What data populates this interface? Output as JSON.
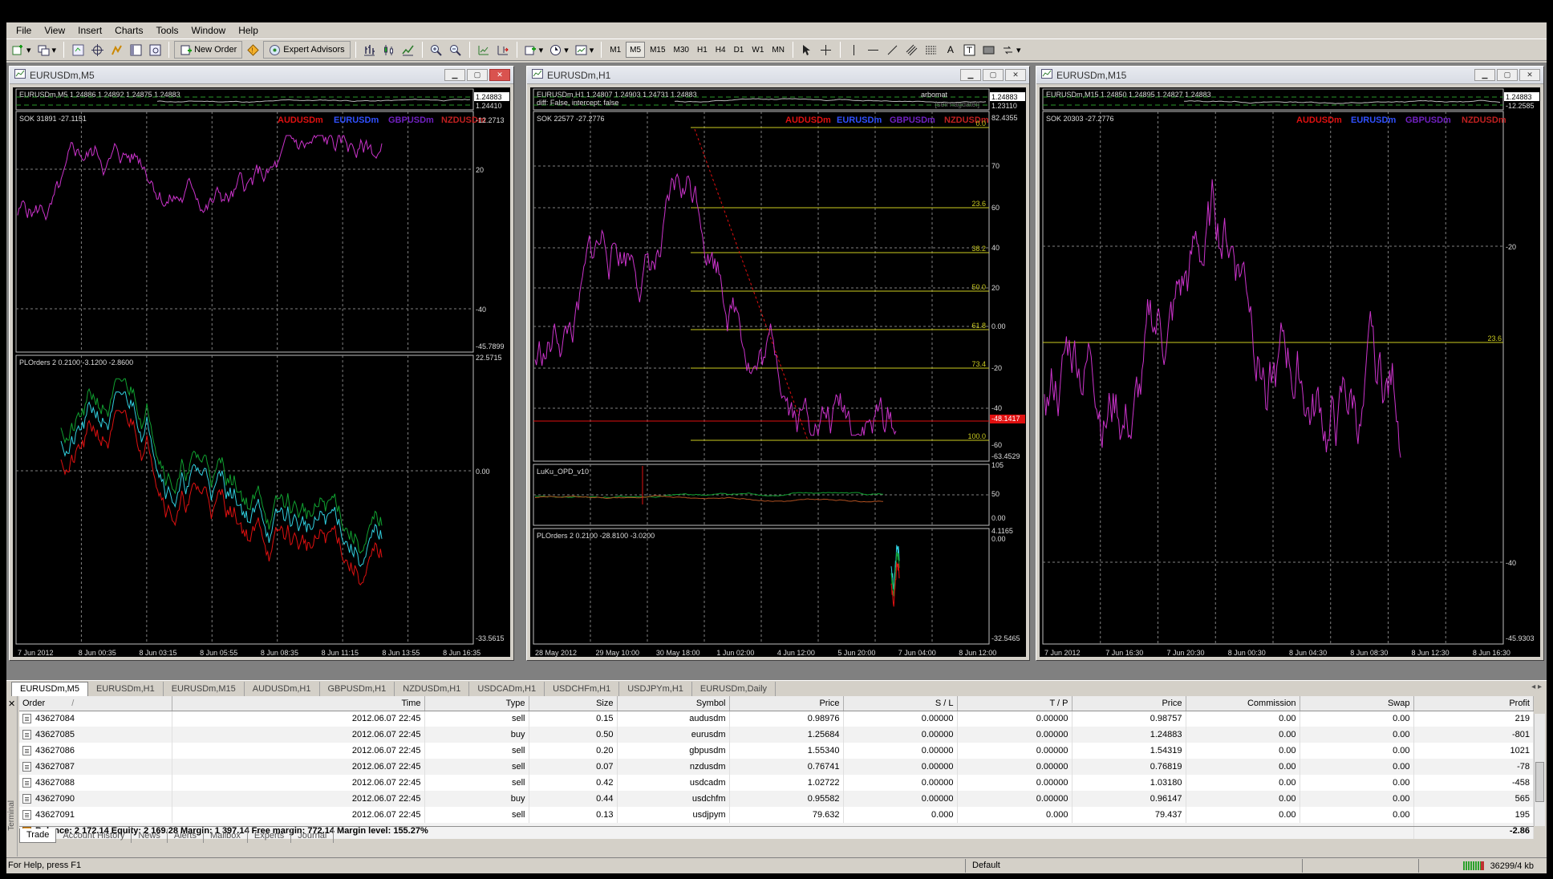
{
  "menu": [
    "File",
    "View",
    "Insert",
    "Charts",
    "Tools",
    "Window",
    "Help"
  ],
  "toolbar": {
    "new_order": "New Order",
    "expert_advisors": "Expert Advisors",
    "timeframes": [
      "M1",
      "M5",
      "M15",
      "M30",
      "H1",
      "H4",
      "D1",
      "W1",
      "MN"
    ],
    "active_timeframe": "M5",
    "text_tool": "A"
  },
  "colors": {
    "magenta": "#cc33cc",
    "red": "#e01010",
    "green": "#10a030",
    "cyan": "#30d0e0",
    "yellow": "#cccc20",
    "blue": "#3050ff",
    "purple": "#7020c0",
    "dark_red": "#c02020",
    "grid": "#808080",
    "axis": "#c0c0c0"
  },
  "windows": [
    {
      "id": "m5",
      "title": "EURUSDm,M5",
      "header": "EURUSDm,M5  1.24886 1.24892 1.24875 1.24883",
      "price_main": "1.24883",
      "price_aux": "1.24410",
      "sok_label": "SOK 31891 -27.1151",
      "legend": [
        "AUDUSDm",
        "EURUSDm",
        "GBPUSDm",
        "NZDUSDm"
      ],
      "sok_scale": [
        "-12.2713",
        "20",
        "-40",
        "-45.7899"
      ],
      "pl_label": "PLOrders 2 0.2100 -3.1200 -2.8600",
      "pl_scale": [
        "22.5715",
        "0.00",
        "-33.5615"
      ],
      "times": [
        "7 Jun 2012",
        "8 Jun 00:35",
        "8 Jun 03:15",
        "8 Jun 05:55",
        "8 Jun 08:35",
        "8 Jun 11:15",
        "8 Jun 13:55",
        "8 Jun 16:35"
      ]
    },
    {
      "id": "h1",
      "title": "EURUSDm,H1",
      "header": "EURUSDm,H1  1.24807 1.24903 1.24731 1.24883",
      "header2": "diff: False, intercept: false",
      "tag_right": "arbomat",
      "tag_right2": "[sell nagdatei]",
      "price_main": "1.24883",
      "price_aux": "1.23110",
      "sok_label": "SOK 22577 -27.2776",
      "legend": [
        "AUDUSDm",
        "EURUSDm",
        "GBPUSDm",
        "NZDUSDm"
      ],
      "sok_scale": [
        "82.4355",
        "70",
        "60",
        "40",
        "20",
        "0.00",
        "-20",
        "-40",
        "-48.1417",
        "-60",
        "-63.4529"
      ],
      "fib_levels": [
        "0.0",
        "23.6",
        "38.2",
        "50.0",
        "61.8",
        "73.4",
        "100.0"
      ],
      "opd_label": "LuKu_OPD_v10",
      "opd_scale": [
        "105",
        "50",
        "0.00"
      ],
      "pl_label": "PLOrders 2 0.2100 -28.8100 -3.0200",
      "pl_scale": [
        "4.1165",
        "0.00",
        "-32.5465"
      ],
      "times": [
        "28 May 2012",
        "29 May 10:00",
        "30 May 18:00",
        "1 Jun 02:00",
        "4 Jun 12:00",
        "5 Jun 20:00",
        "7 Jun 04:00",
        "8 Jun 12:00"
      ]
    },
    {
      "id": "m15",
      "title": "EURUSDm,M15",
      "header": "EURUSDm,M15  1.24850 1.24895 1.24827 1.24883",
      "price_main": "1.24883",
      "price_aux": "-12.2585",
      "sok_label": "SOK 20303 -27.2776",
      "legend": [
        "AUDUSDm",
        "EURUSDm",
        "GBPUSDm",
        "NZDUSDm"
      ],
      "sok_scale": [
        "-20",
        "23.6",
        "-40",
        "-45.9303"
      ],
      "times": [
        "7 Jun 2012",
        "7 Jun 16:30",
        "7 Jun 20:30",
        "8 Jun 00:30",
        "8 Jun 04:30",
        "8 Jun 08:30",
        "8 Jun 12:30",
        "8 Jun 16:30"
      ]
    }
  ],
  "chart_tabs": [
    "EURUSDm,M5",
    "EURUSDm,H1",
    "EURUSDm,M15",
    "AUDUSDm,H1",
    "GBPUSDm,H1",
    "NZDUSDm,H1",
    "USDCADm,H1",
    "USDCHFm,H1",
    "USDJPYm,H1",
    "EURUSDm,Daily"
  ],
  "terminal": {
    "side_label": "Terminal",
    "columns": [
      "Order",
      "Time",
      "Type",
      "Size",
      "Symbol",
      "Price",
      "S / L",
      "T / P",
      "Price",
      "Commission",
      "Swap",
      "Profit"
    ],
    "sort_marker": "/",
    "rows": [
      [
        "43627084",
        "2012.06.07 22:45",
        "sell",
        "0.15",
        "audusdm",
        "0.98976",
        "0.00000",
        "0.00000",
        "0.98757",
        "0.00",
        "0.00",
        "219"
      ],
      [
        "43627085",
        "2012.06.07 22:45",
        "buy",
        "0.50",
        "eurusdm",
        "1.25684",
        "0.00000",
        "0.00000",
        "1.24883",
        "0.00",
        "0.00",
        "-801"
      ],
      [
        "43627086",
        "2012.06.07 22:45",
        "sell",
        "0.20",
        "gbpusdm",
        "1.55340",
        "0.00000",
        "0.00000",
        "1.54319",
        "0.00",
        "0.00",
        "1021"
      ],
      [
        "43627087",
        "2012.06.07 22:45",
        "sell",
        "0.07",
        "nzdusdm",
        "0.76741",
        "0.00000",
        "0.00000",
        "0.76819",
        "0.00",
        "0.00",
        "-78"
      ],
      [
        "43627088",
        "2012.06.07 22:45",
        "sell",
        "0.42",
        "usdcadm",
        "1.02722",
        "0.00000",
        "0.00000",
        "1.03180",
        "0.00",
        "0.00",
        "-458"
      ],
      [
        "43627090",
        "2012.06.07 22:45",
        "buy",
        "0.44",
        "usdchfm",
        "0.95582",
        "0.00000",
        "0.00000",
        "0.96147",
        "0.00",
        "0.00",
        "565"
      ],
      [
        "43627091",
        "2012.06.07 22:45",
        "sell",
        "0.13",
        "usdjpym",
        "79.632",
        "0.000",
        "0.000",
        "79.437",
        "0.00",
        "0.00",
        "195"
      ]
    ],
    "balance_line": "Balance: 2 172.14  Equity: 2 169.28  Margin: 1 397.14  Free margin: 772.14  Margin level: 155.27%",
    "balance_profit": "-2.86",
    "tabs": [
      "Trade",
      "Account History",
      "News",
      "Alerts",
      "Mailbox",
      "Experts",
      "Journal"
    ],
    "active_tab": "Trade"
  },
  "status": {
    "help": "For Help, press F1",
    "profile": "Default",
    "traffic": "36299/4 kb"
  }
}
